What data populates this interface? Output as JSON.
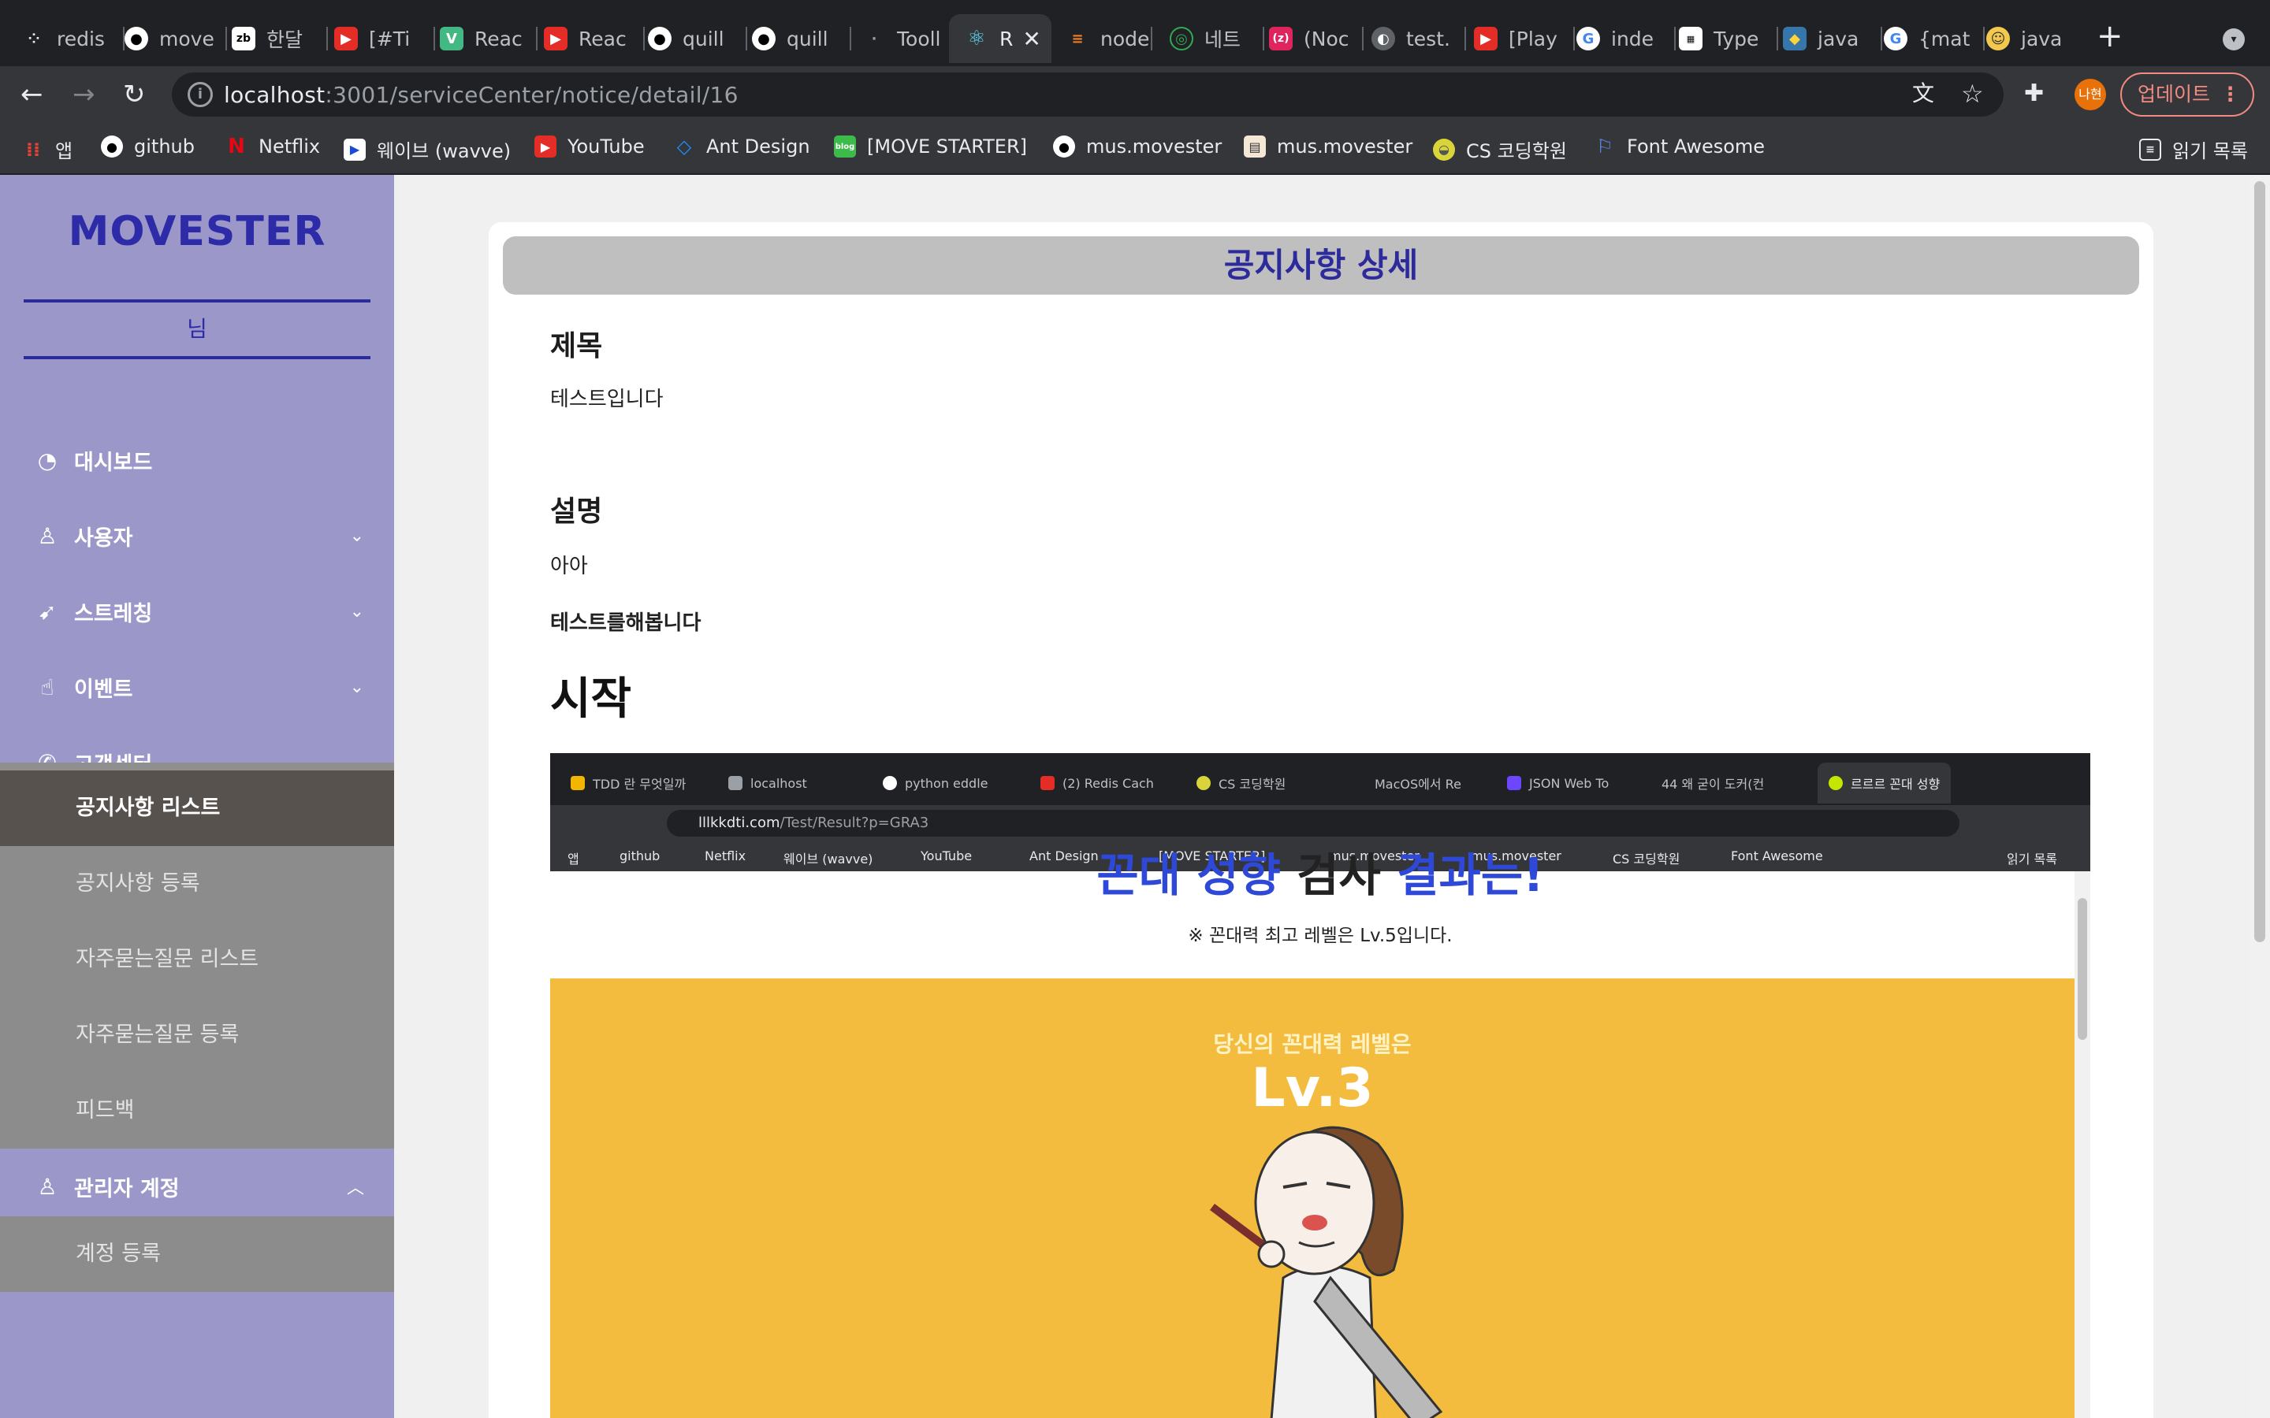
{
  "browser": {
    "tabs": [
      {
        "label": "redis",
        "icon": "redis-icon"
      },
      {
        "label": "move",
        "icon": "github-icon"
      },
      {
        "label": "한달",
        "icon": "zb-icon"
      },
      {
        "label": "[#Ti",
        "icon": "youtube-icon"
      },
      {
        "label": "Reac",
        "icon": "vue-icon"
      },
      {
        "label": "Reac",
        "icon": "youtube-icon"
      },
      {
        "label": "quill",
        "icon": "github-icon"
      },
      {
        "label": "quill",
        "icon": "github-icon"
      },
      {
        "label": "Tooll",
        "icon": "blank-icon"
      },
      {
        "label": "R",
        "icon": "react-icon"
      },
      {
        "label": "node",
        "icon": "stackoverflow-icon"
      },
      {
        "label": "네트",
        "icon": "network-icon"
      },
      {
        "label": "(Noc",
        "icon": "zero-icon"
      },
      {
        "label": "test.",
        "icon": "globe-icon"
      },
      {
        "label": "[Play",
        "icon": "youtube-icon"
      },
      {
        "label": "inde",
        "icon": "google-icon"
      },
      {
        "label": "Type",
        "icon": "qr-icon"
      },
      {
        "label": "java",
        "icon": "python-icon"
      },
      {
        "label": "{mat",
        "icon": "google-icon"
      },
      {
        "label": "java",
        "icon": "face-icon"
      }
    ],
    "url_host": "localhost",
    "url_path": ":3001/serviceCenter/notice/detail/16",
    "profile_label": "나현",
    "update_label": "업데이트",
    "bookmarks": [
      {
        "label": "앱",
        "icon": "apps-grid-icon"
      },
      {
        "label": "github",
        "icon": "github-icon"
      },
      {
        "label": "Netflix",
        "icon": "netflix-icon"
      },
      {
        "label": "웨이브 (wavve)",
        "icon": "wavve-icon"
      },
      {
        "label": "YouTube",
        "icon": "youtube-icon"
      },
      {
        "label": "Ant Design",
        "icon": "antdesign-icon"
      },
      {
        "label": "[MOVE STARTER]",
        "icon": "blog-icon"
      },
      {
        "label": "mus.movester",
        "icon": "github-icon"
      },
      {
        "label": "mus.movester",
        "icon": "notion-icon"
      },
      {
        "label": "CS 코딩학원",
        "icon": "tennis-icon"
      },
      {
        "label": "Font Awesome",
        "icon": "flag-icon"
      }
    ],
    "reading_list": "읽기 목록"
  },
  "sidebar": {
    "logo": "MOVESTER",
    "user_label": "님",
    "menu": [
      {
        "label": "대시보드",
        "icon": "dashboard-icon"
      },
      {
        "label": "사용자",
        "icon": "user-icon"
      },
      {
        "label": "스트레칭",
        "icon": "pointer-icon"
      },
      {
        "label": "이벤트",
        "icon": "like-icon"
      },
      {
        "label": "고객센터",
        "icon": "whatsapp-icon"
      },
      {
        "label": "관리자 계정",
        "icon": "user-icon"
      }
    ],
    "customer_center_items": [
      "공지사항 리스트",
      "공지사항 등록",
      "자주묻는질문 리스트",
      "자주묻는질문 등록",
      "피드백"
    ],
    "admin_items": [
      "계정 등록"
    ]
  },
  "detail": {
    "heading": "공지사항 상세",
    "title_label": "제목",
    "title_value": "테스트입니다",
    "desc_label": "설명",
    "desc_line1": "아아",
    "desc_line2": "테스트를해봅니다",
    "desc_heading": "시작"
  },
  "embedded": {
    "tabs": [
      "TDD 란 무엇일까",
      "localhost",
      "python eddle",
      "(2) Redis Cach",
      "CS 코딩학원",
      "MacOS에서 Re",
      "JSON Web To",
      "44 왜 굳이 도커(컨",
      "르르르 꼰대 성향"
    ],
    "url_host": "lllkkdti.com",
    "url_path": "/Test/Result?p=GRA3",
    "bookmarks": [
      "앱",
      "github",
      "Netflix",
      "웨이브 (wavve)",
      "YouTube",
      "Ant Design",
      "[MOVE STARTER]",
      "mus.movester",
      "mus.movester",
      "CS 코딩학원",
      "Font Awesome",
      "읽기 목록"
    ],
    "result_title_part1": "꼰대 성향",
    "result_title_part2": "검사",
    "result_title_part3": "결과는!",
    "note": "※ 꼰대력 최고 레벨은 Lv.5입니다.",
    "level_label": "당신의 꼰대력 레벨은",
    "level_value": "Lv.3"
  },
  "colors": {
    "sidebar_bg": "#9b98c9",
    "accent": "#2d2ba7",
    "submenu_bg": "#8c8c8c",
    "submenu_active": "#58524f",
    "result_yellow": "#f4bc3f"
  }
}
